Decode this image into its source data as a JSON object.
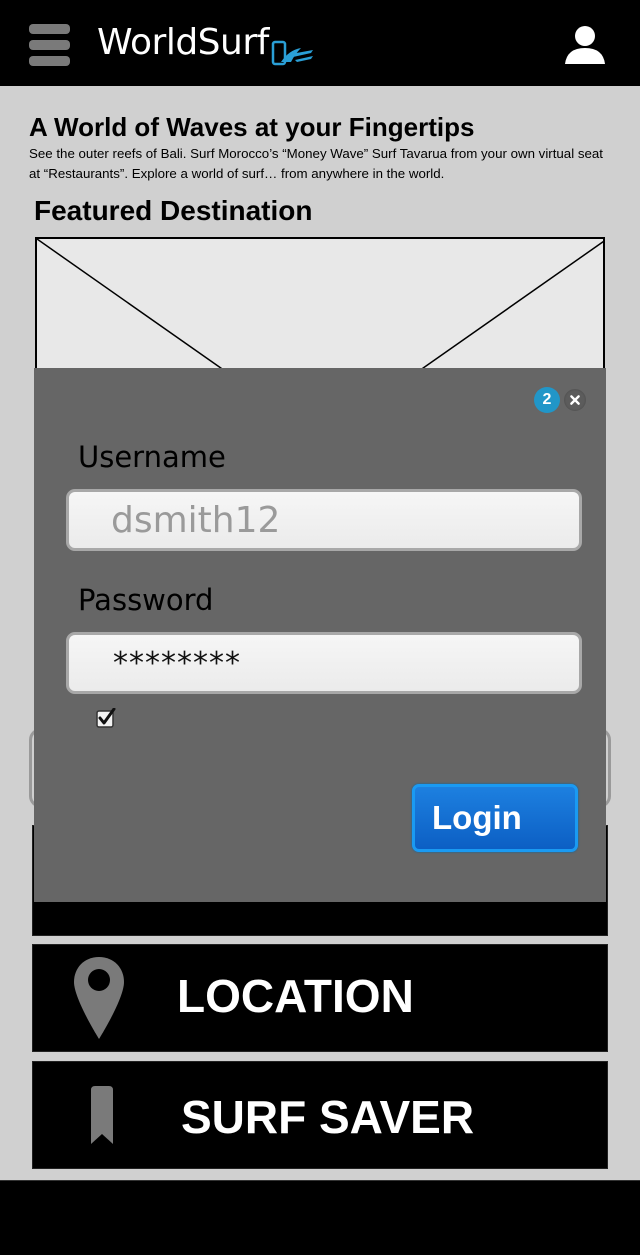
{
  "header": {
    "app_title": "WorldSurf"
  },
  "intro": {
    "headline": "A World of Waves at your Fingertips",
    "description": "See the outer reefs of Bali. Surf Morocco’s “Money Wave” Surf Tavarua from your own virtual seat at “Restaurants”. Explore a world of surf… from anywhere in the world."
  },
  "featured": {
    "title": "Featured Destination"
  },
  "menu": {
    "items": [
      {
        "label": "LOCATION",
        "icon": "map-pin-icon"
      },
      {
        "label": "SURF SAVER",
        "icon": "bookmark-icon"
      }
    ]
  },
  "login_modal": {
    "badge": "2",
    "username_label": "Username",
    "username_value": "dsmith12",
    "password_label": "Password",
    "password_value": "********",
    "remember_checked": true,
    "login_label": "Login"
  },
  "colors": {
    "header_bg": "#000000",
    "page_bg": "#d0d0d0",
    "modal_bg": "#666666",
    "accent_blue": "#2196c8",
    "login_button": "#0c6ad4"
  }
}
